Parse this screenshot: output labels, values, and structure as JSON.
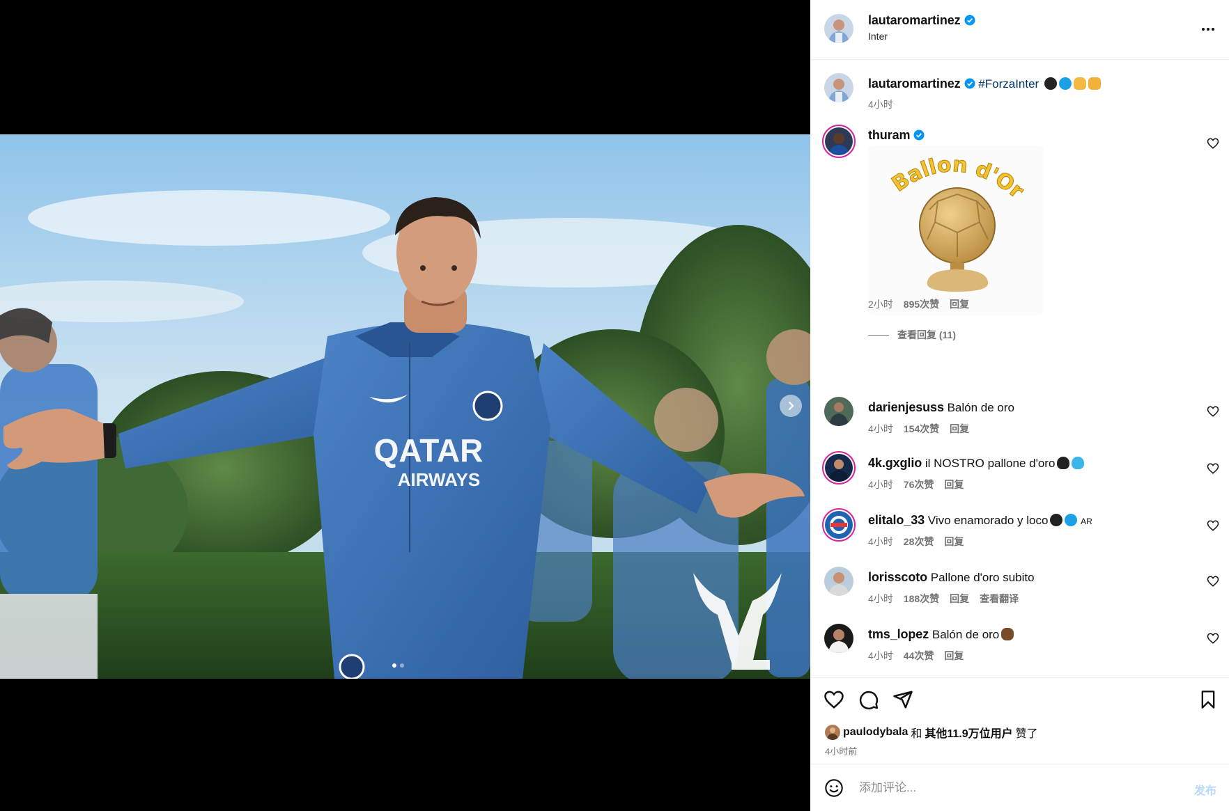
{
  "post": {
    "author": "lautaromartinez",
    "location": "Inter",
    "caption_user": "lautaromartinez",
    "caption_hashtag": "#ForzaInter",
    "caption_time": "4小时",
    "carousel_total": 2,
    "carousel_index": 1
  },
  "comments": [
    {
      "user": "thuram",
      "text": "",
      "time": "2小时",
      "likes": "895次赞",
      "reply": "回复",
      "view_replies": "查看回复 (11)",
      "sticker_text": "Ballon d'Or",
      "verified": true
    },
    {
      "user": "darienjesuss",
      "text": "Balón de oro",
      "time": "4小时",
      "likes": "154次赞",
      "reply": "回复"
    },
    {
      "user": "4k.gxglio",
      "text": "il NOSTRO pallone d'oro",
      "time": "4小时",
      "likes": "76次赞",
      "reply": "回复"
    },
    {
      "user": "elitalo_33",
      "text": "Vivo enamorado y loco",
      "text_suffix": "AR",
      "time": "4小时",
      "likes": "28次赞",
      "reply": "回复"
    },
    {
      "user": "lorisscoto",
      "text": "Pallone d'oro subito",
      "time": "4小时",
      "likes": "188次赞",
      "reply": "回复",
      "translate": "查看翻译"
    },
    {
      "user": "tms_lopez",
      "text": "Balón de oro",
      "time": "4小时",
      "likes": "44次赞",
      "reply": "回复"
    }
  ],
  "likes": {
    "user": "paulodybala",
    "connector": "和",
    "others": "其他11.9万位用户",
    "suffix": "赞了",
    "time": "4小时前"
  },
  "composer": {
    "placeholder": "添加评论...",
    "post_label": "发布"
  },
  "colors": {
    "verified": "#0095f6",
    "link": "#00376b",
    "muted": "#737373",
    "post_disabled": "#b8d9f8",
    "jersey": "#3a6fb8"
  },
  "icons": [
    "verified-badge-icon",
    "more-icon",
    "heart-icon",
    "comment-icon",
    "share-icon",
    "bookmark-icon",
    "emoji-icon",
    "chevron-right-icon"
  ]
}
